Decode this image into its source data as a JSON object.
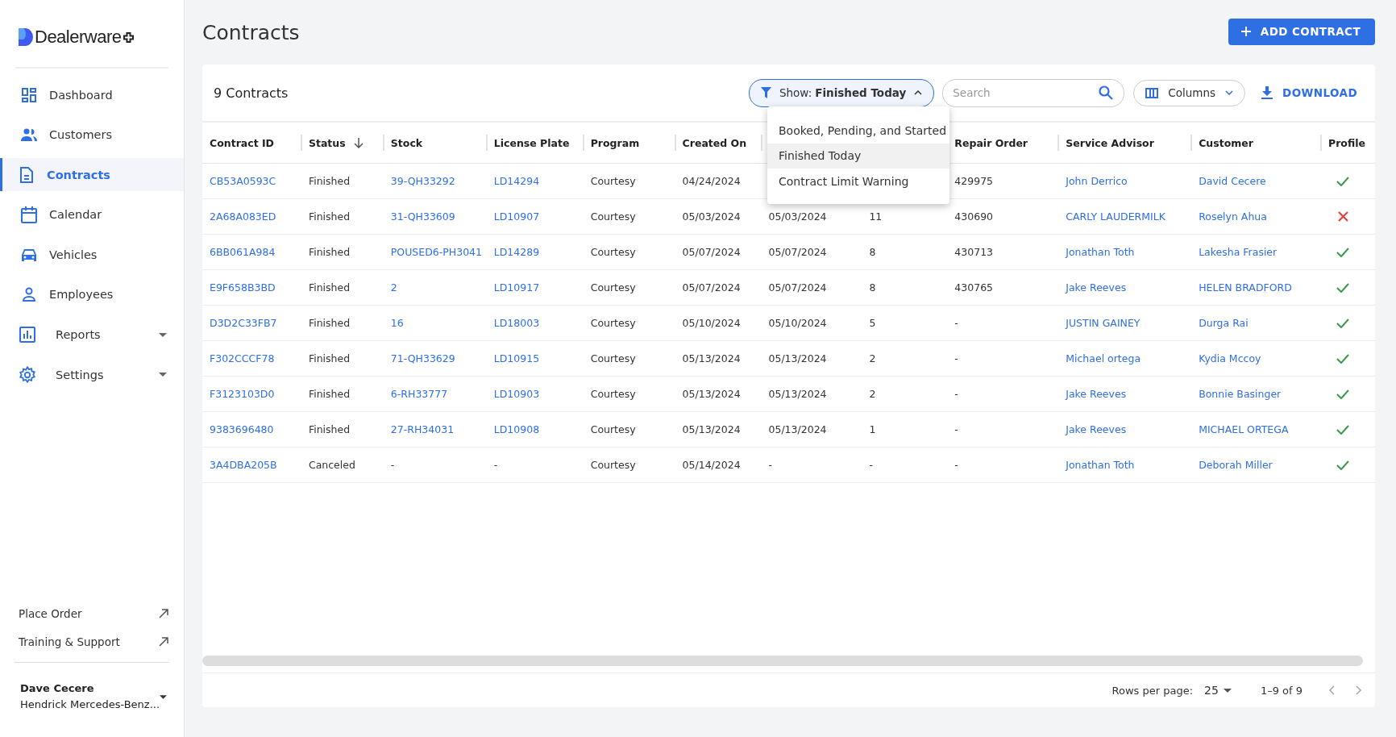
{
  "sidebar": {
    "logo": "Dealerware",
    "items": [
      {
        "label": "Dashboard",
        "kind": "link",
        "selected": false
      },
      {
        "label": "Customers",
        "kind": "link",
        "selected": false
      },
      {
        "label": "Contracts",
        "kind": "link",
        "selected": true
      },
      {
        "label": "Calendar",
        "kind": "link",
        "selected": false
      },
      {
        "label": "Vehicles",
        "kind": "link",
        "selected": false
      },
      {
        "label": "Employees",
        "kind": "link",
        "selected": false
      },
      {
        "label": "Reports",
        "kind": "group",
        "selected": false
      },
      {
        "label": "Settings",
        "kind": "group",
        "selected": false
      }
    ],
    "external_links": [
      "Place Order",
      "Training & Support"
    ],
    "user": {
      "name": "Dave Cecere",
      "dealership": "Hendrick Mercedes-Benz..."
    }
  },
  "page": {
    "title": "Contracts",
    "add_button": "ADD CONTRACT"
  },
  "toolbar": {
    "count": "9 Contracts",
    "filter_label": "Show:",
    "filter_value": "Finished Today",
    "search": {
      "placeholder": "Search"
    },
    "columns_button": "Columns",
    "download_button": "DOWNLOAD"
  },
  "filter_menu": [
    {
      "label": "Booked, Pending, and Started",
      "selected": false
    },
    {
      "label": "Finished Today",
      "selected": true
    },
    {
      "label": "Contract Limit Warning",
      "selected": false
    }
  ],
  "table": {
    "columns": [
      {
        "label": "Contract ID",
        "kind": "link",
        "sorted": false
      },
      {
        "label": "Status",
        "kind": "text",
        "sorted": true
      },
      {
        "label": "Stock",
        "kind": "link",
        "sorted": false
      },
      {
        "label": "License Plate",
        "kind": "link",
        "sorted": false
      },
      {
        "label": "Program",
        "kind": "text",
        "sorted": false
      },
      {
        "label": "Created On",
        "kind": "text",
        "sorted": false
      },
      {
        "kind": "text"
      },
      {
        "kind": "text"
      },
      {
        "label": "Repair Order",
        "kind": "text",
        "sorted": false
      },
      {
        "label": "Service Advisor",
        "kind": "link",
        "sorted": false
      },
      {
        "label": "Customer",
        "kind": "link",
        "sorted": false
      },
      {
        "label": "Profile",
        "sorted": false
      }
    ],
    "rows": [
      {
        "cells": [
          "CB53A0593C",
          "Finished",
          "39-QH33292",
          "LD14294",
          "Courtesy",
          "04/24/2024",
          null,
          null,
          "429975",
          "John Derrico",
          "David Cecere"
        ],
        "profile_ok": true
      },
      {
        "cells": [
          "2A68A083ED",
          "Finished",
          "31-QH33609",
          "LD10907",
          "Courtesy",
          "05/03/2024",
          "05/03/2024",
          "11",
          "430690",
          "CARLY LAUDERMILK",
          "Roselyn Ahua"
        ],
        "profile_ok": false
      },
      {
        "cells": [
          "6BB061A984",
          "Finished",
          "POUSED6-PH3041",
          "LD14289",
          "Courtesy",
          "05/07/2024",
          "05/07/2024",
          "8",
          "430713",
          "Jonathan Toth",
          "Lakesha Frasier"
        ],
        "profile_ok": true
      },
      {
        "cells": [
          "E9F658B3BD",
          "Finished",
          "2",
          "LD10917",
          "Courtesy",
          "05/07/2024",
          "05/07/2024",
          "8",
          "430765",
          "Jake Reeves",
          "HELEN BRADFORD"
        ],
        "profile_ok": true
      },
      {
        "cells": [
          "D3D2C33FB7",
          "Finished",
          "16",
          "LD18003",
          "Courtesy",
          "05/10/2024",
          "05/10/2024",
          "5",
          "-",
          "JUSTIN GAINEY",
          "Durga Rai"
        ],
        "profile_ok": true
      },
      {
        "cells": [
          "F302CCCF78",
          "Finished",
          "71-QH33629",
          "LD10915",
          "Courtesy",
          "05/13/2024",
          "05/13/2024",
          "2",
          "-",
          "Michael ortega",
          "Kydia Mccoy"
        ],
        "profile_ok": true
      },
      {
        "cells": [
          "F3123103D0",
          "Finished",
          "6-RH33777",
          "LD10903",
          "Courtesy",
          "05/13/2024",
          "05/13/2024",
          "2",
          "-",
          "Jake Reeves",
          "Bonnie Basinger"
        ],
        "profile_ok": true
      },
      {
        "cells": [
          "9383696480",
          "Finished",
          "27-RH34031",
          "LD10908",
          "Courtesy",
          "05/13/2024",
          "05/13/2024",
          "1",
          "-",
          "Jake Reeves",
          "MICHAEL ORTEGA"
        ],
        "profile_ok": true
      },
      {
        "cells": [
          "3A4DBA205B",
          "Canceled",
          "-",
          "-",
          "Courtesy",
          "05/14/2024",
          "-",
          "-",
          "-",
          "Jonathan Toth",
          "Deborah Miller"
        ],
        "profile_ok": true
      }
    ]
  },
  "pagination": {
    "rows_per_page_label": "Rows per page:",
    "rows_per_page": "25",
    "range": "1–9 of 9"
  }
}
